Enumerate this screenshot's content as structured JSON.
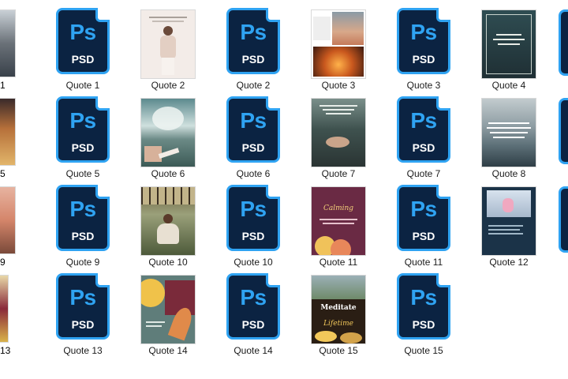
{
  "psd_icon": {
    "glyph": "Ps",
    "ext": "PSD",
    "accent": "#2fa3f2",
    "fill": "#0b2342"
  },
  "files": [
    {
      "label": "Quote 1",
      "type": "psd"
    },
    {
      "label": "Quote 2",
      "type": "image",
      "thumb": "thumb-woman-pose"
    },
    {
      "label": "Quote 2",
      "type": "psd"
    },
    {
      "label": "Quote 3",
      "type": "image",
      "thumb": "thumb-collage-candles"
    },
    {
      "label": "Quote 3",
      "type": "psd"
    },
    {
      "label": "Quote 4",
      "type": "image",
      "thumb": "thumb-dark-teal-quote"
    },
    {
      "label": "Quote 5",
      "type": "psd"
    },
    {
      "label": "Quote 6",
      "type": "image",
      "thumb": "thumb-clouds-sea"
    },
    {
      "label": "Quote 6",
      "type": "psd"
    },
    {
      "label": "Quote 7",
      "type": "image",
      "thumb": "thumb-water-woman"
    },
    {
      "label": "Quote 7",
      "type": "psd"
    },
    {
      "label": "Quote 8",
      "type": "image",
      "thumb": "thumb-ocean-waves"
    },
    {
      "label": "Quote 9",
      "type": "psd"
    },
    {
      "label": "Quote 10",
      "type": "image",
      "thumb": "thumb-greenhouse-meditation"
    },
    {
      "label": "Quote 10",
      "type": "psd"
    },
    {
      "label": "Quote 11",
      "type": "image",
      "thumb": "thumb-purple-yoga"
    },
    {
      "label": "Quote 11",
      "type": "psd"
    },
    {
      "label": "Quote 12",
      "type": "image",
      "thumb": "thumb-navy-meditation"
    },
    {
      "label": "Quote 13",
      "type": "psd"
    },
    {
      "label": "Quote 14",
      "type": "image",
      "thumb": "thumb-boho-leaves"
    },
    {
      "label": "Quote 14",
      "type": "psd"
    },
    {
      "label": "Quote 15",
      "type": "image",
      "thumb": "thumb-meditate-lifetime"
    },
    {
      "label": "Quote 15",
      "type": "psd"
    }
  ],
  "thumb_texts": {
    "quote11": "Calming",
    "quote15_title": "Meditate",
    "quote15_sub": "Lifetime"
  },
  "partial": {
    "left_labels": [
      "1",
      "5",
      "9",
      "13"
    ],
    "right_icons": 3
  }
}
